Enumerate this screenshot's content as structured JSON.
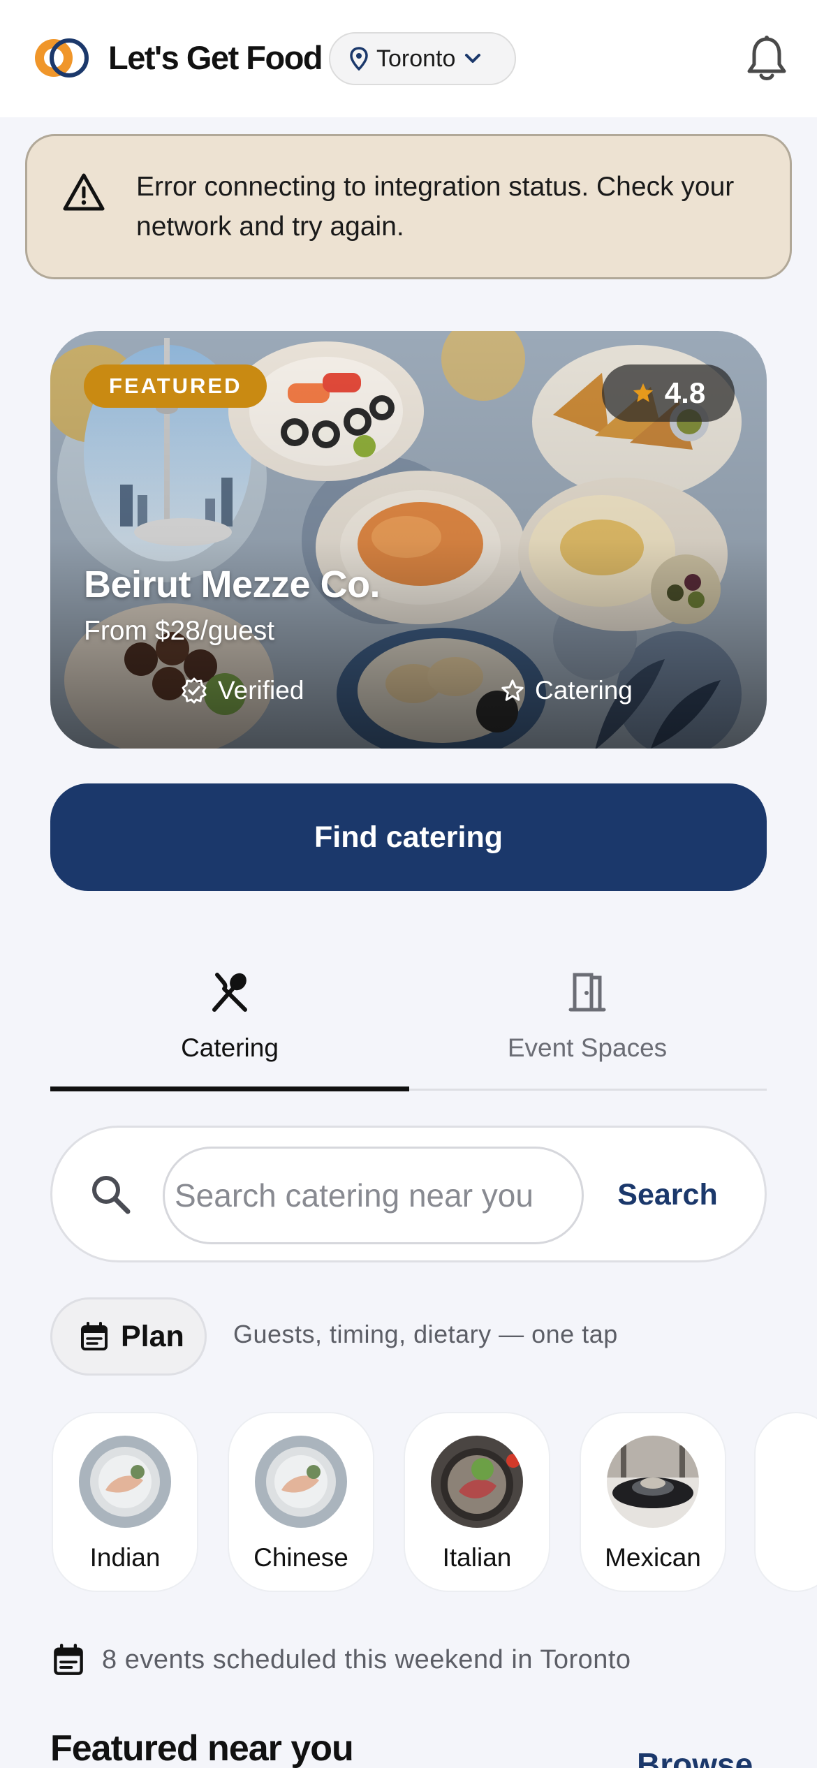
{
  "header": {
    "brand": "Let's Get Food",
    "city": "Toronto"
  },
  "error": {
    "message": "Error connecting to integration status. Check your network and try again."
  },
  "featured": {
    "badge": "FEATURED",
    "rating": "4.8",
    "name": "Beirut Mezze Co.",
    "price": "From $28/guest",
    "verified": "Verified",
    "category": "Catering"
  },
  "cta": {
    "label": "Find catering"
  },
  "tabs": [
    {
      "label": "Catering",
      "icon": "utensils-crossed-icon",
      "active": true
    },
    {
      "label": "Event Spaces",
      "icon": "door-icon",
      "active": false
    }
  ],
  "search": {
    "placeholder": "Search catering near you",
    "button": "Search"
  },
  "plan": {
    "label": "Plan",
    "hint": "Guests, timing, dietary — one tap"
  },
  "cuisines": [
    {
      "label": "Indian"
    },
    {
      "label": "Chinese"
    },
    {
      "label": "Italian"
    },
    {
      "label": "Mexican"
    }
  ],
  "events": {
    "text": "8 events scheduled this weekend in Toronto"
  },
  "featured_section": {
    "title": "Featured near you",
    "link": "Browse"
  },
  "colors": {
    "primary": "#1b386b",
    "badge": "#c98a12",
    "banner_bg": "#ede2d2",
    "page_bg": "#f4f5fa"
  }
}
